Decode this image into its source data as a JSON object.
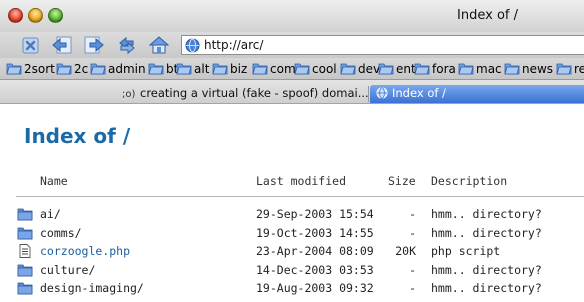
{
  "window": {
    "title": "Index of /"
  },
  "toolbar": {
    "url": "http://arc/",
    "buttons": [
      "stop-icon",
      "back-icon",
      "forward-icon",
      "reload-icon",
      "home-icon"
    ]
  },
  "bookmarks": [
    "2sort",
    "2c",
    "admin",
    "bt",
    "alt",
    "biz",
    "com",
    "cool",
    "dev",
    "ent",
    "fora",
    "mac",
    "news",
    "ref"
  ],
  "tabs": [
    {
      "icon": ";o)",
      "label": "creating a virtual (fake - spoof) domai..."
    },
    {
      "label": "Index of /"
    }
  ],
  "page": {
    "title": "Index of /",
    "columns": {
      "name": "Name",
      "modified": "Last modified",
      "size": "Size",
      "description": "Description"
    },
    "rows": [
      {
        "type": "folder",
        "name": "ai/",
        "modified": "29-Sep-2003 15:54",
        "size": "-",
        "description": "hmm.. directory?"
      },
      {
        "type": "folder",
        "name": "comms/",
        "modified": "19-Oct-2003 14:55",
        "size": "-",
        "description": "hmm.. directory?"
      },
      {
        "type": "file",
        "name": "corzoogle.php",
        "modified": "23-Apr-2004 08:09",
        "size": "20K",
        "description": "php script"
      },
      {
        "type": "folder",
        "name": "culture/",
        "modified": "14-Dec-2003 03:53",
        "size": "-",
        "description": "hmm.. directory?"
      },
      {
        "type": "folder",
        "name": "design-imaging/",
        "modified": "19-Aug-2003 09:32",
        "size": "-",
        "description": "hmm.. directory?"
      }
    ]
  },
  "colors": {
    "accent": "#1a6aa8",
    "active_tab": "#3a72d4"
  }
}
